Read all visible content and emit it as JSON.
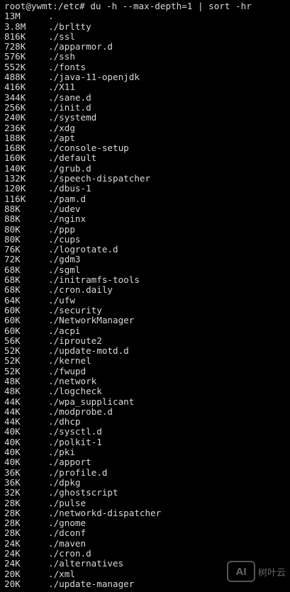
{
  "terminal": {
    "prompt": "root@ywmt:/etc# du -h --max-depth=1 | sort -hr",
    "rows": [
      {
        "size": "13M",
        "path": "."
      },
      {
        "size": "3.8M",
        "path": "./brltty"
      },
      {
        "size": "816K",
        "path": "./ssl"
      },
      {
        "size": "728K",
        "path": "./apparmor.d"
      },
      {
        "size": "576K",
        "path": "./ssh"
      },
      {
        "size": "552K",
        "path": "./fonts"
      },
      {
        "size": "488K",
        "path": "./java-11-openjdk"
      },
      {
        "size": "416K",
        "path": "./X11"
      },
      {
        "size": "344K",
        "path": "./sane.d"
      },
      {
        "size": "256K",
        "path": "./init.d"
      },
      {
        "size": "240K",
        "path": "./systemd"
      },
      {
        "size": "236K",
        "path": "./xdg"
      },
      {
        "size": "188K",
        "path": "./apt"
      },
      {
        "size": "168K",
        "path": "./console-setup"
      },
      {
        "size": "160K",
        "path": "./default"
      },
      {
        "size": "140K",
        "path": "./grub.d"
      },
      {
        "size": "132K",
        "path": "./speech-dispatcher"
      },
      {
        "size": "120K",
        "path": "./dbus-1"
      },
      {
        "size": "116K",
        "path": "./pam.d"
      },
      {
        "size": "88K",
        "path": "./udev"
      },
      {
        "size": "88K",
        "path": "./nginx"
      },
      {
        "size": "80K",
        "path": "./ppp"
      },
      {
        "size": "80K",
        "path": "./cups"
      },
      {
        "size": "76K",
        "path": "./logrotate.d"
      },
      {
        "size": "72K",
        "path": "./gdm3"
      },
      {
        "size": "68K",
        "path": "./sgml"
      },
      {
        "size": "68K",
        "path": "./initramfs-tools"
      },
      {
        "size": "68K",
        "path": "./cron.daily"
      },
      {
        "size": "64K",
        "path": "./ufw"
      },
      {
        "size": "60K",
        "path": "./security"
      },
      {
        "size": "60K",
        "path": "./NetworkManager"
      },
      {
        "size": "60K",
        "path": "./acpi"
      },
      {
        "size": "56K",
        "path": "./iproute2"
      },
      {
        "size": "52K",
        "path": "./update-motd.d"
      },
      {
        "size": "52K",
        "path": "./kernel"
      },
      {
        "size": "52K",
        "path": "./fwupd"
      },
      {
        "size": "48K",
        "path": "./network"
      },
      {
        "size": "48K",
        "path": "./logcheck"
      },
      {
        "size": "44K",
        "path": "./wpa_supplicant"
      },
      {
        "size": "44K",
        "path": "./modprobe.d"
      },
      {
        "size": "44K",
        "path": "./dhcp"
      },
      {
        "size": "40K",
        "path": "./sysctl.d"
      },
      {
        "size": "40K",
        "path": "./polkit-1"
      },
      {
        "size": "40K",
        "path": "./pki"
      },
      {
        "size": "40K",
        "path": "./apport"
      },
      {
        "size": "36K",
        "path": "./profile.d"
      },
      {
        "size": "36K",
        "path": "./dpkg"
      },
      {
        "size": "32K",
        "path": "./ghostscript"
      },
      {
        "size": "28K",
        "path": "./pulse"
      },
      {
        "size": "28K",
        "path": "./networkd-dispatcher"
      },
      {
        "size": "28K",
        "path": "./gnome"
      },
      {
        "size": "28K",
        "path": "./dconf"
      },
      {
        "size": "24K",
        "path": "./maven"
      },
      {
        "size": "24K",
        "path": "./cron.d"
      },
      {
        "size": "24K",
        "path": "./alternatives"
      },
      {
        "size": "20K",
        "path": "./xml"
      },
      {
        "size": "20K",
        "path": "./update-manager"
      }
    ]
  },
  "watermark": {
    "logo": "AI",
    "text": "树叶云"
  },
  "colors": {
    "background": "#000000",
    "foreground": "#d8d8d8"
  }
}
